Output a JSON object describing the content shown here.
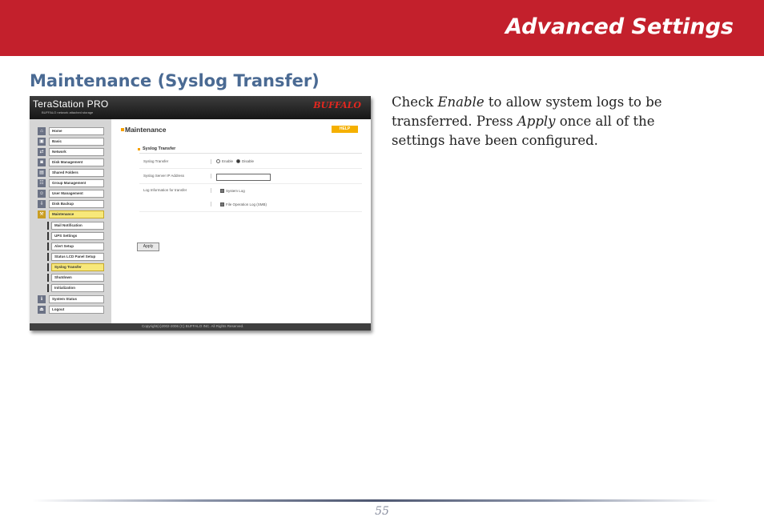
{
  "header": {
    "title": "Advanced Settings"
  },
  "section": {
    "title": "Maintenance (Syslog Transfer)"
  },
  "body": {
    "p1": "Check ",
    "em1": "Enable",
    "p2": " to allow system logs to be transferred.  Press ",
    "em2": "Apply",
    "p3": " once all of the settings have been configured."
  },
  "screenshot": {
    "brand": "TeraStation PRO",
    "brand_sub": "BUFFALO network attached storage",
    "logo": "BUFFALO",
    "nav": [
      {
        "label": "Home",
        "icon": "home-icon"
      },
      {
        "label": "Basic",
        "icon": "basic-icon"
      },
      {
        "label": "Network",
        "icon": "network-icon"
      },
      {
        "label": "Disk Management",
        "icon": "disk-icon"
      },
      {
        "label": "Shared Folders",
        "icon": "folder-icon"
      },
      {
        "label": "Group Management",
        "icon": "group-icon"
      },
      {
        "label": "User Management",
        "icon": "user-icon"
      },
      {
        "label": "Disk Backup",
        "icon": "backup-icon"
      },
      {
        "label": "Maintenance",
        "icon": "wrench-icon"
      }
    ],
    "subnav": [
      "Mail Notification",
      "UPS Settings",
      "Alert Setup",
      "Status LCD Panel Setup",
      "Syslog Transfer",
      "Shutdown",
      "Initialization"
    ],
    "nav_bottom": [
      {
        "label": "System Status",
        "icon": "status-icon"
      },
      {
        "label": "Logout",
        "icon": "logout-icon"
      }
    ],
    "main_title": "Maintenance",
    "help_label": "HELP",
    "section_title": "Syslog Transfer",
    "fields": {
      "transfer_label": "Syslog Transfer",
      "enable_label": "Enable",
      "disable_label": "Disable",
      "ip_label": "Syslog Server IP Address",
      "ip_value": "",
      "log_label": "Log Information for transfer",
      "system_log_label": "System Log",
      "file_log_label": "File Operation Log (SMB)"
    },
    "apply_label": "Apply",
    "footer": "Copyright(c)2002-2006 (C) BUFFALO INC. All Rights Reserved."
  },
  "page_number": "55",
  "colors": {
    "header_bg": "#c3202c",
    "section_title": "#4a6a93",
    "active_nav": "#f7e87a"
  }
}
